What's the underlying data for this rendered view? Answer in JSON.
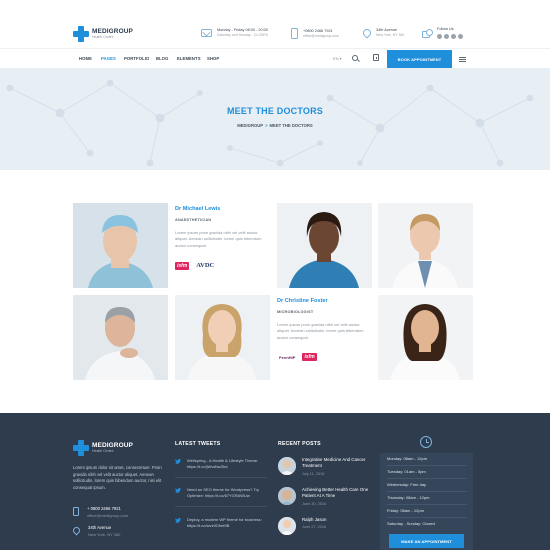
{
  "brand": {
    "name": "MEDIGROUP",
    "tagline": "Health Centre"
  },
  "header": {
    "hours": {
      "line1": "Monday - Friday 08:00 - 20:00",
      "line2": "Saturday and Sunday - CLOSED"
    },
    "contact": {
      "line1": "+0800 2466 7921",
      "line2": "office@medigroup.com"
    },
    "address": {
      "line1": "34th Avenue",
      "line2": "New York, NY 360"
    },
    "follow": {
      "title": "Follow Us"
    }
  },
  "nav": {
    "items": [
      "HOME",
      "PAGES",
      "PORTFOLIO",
      "BLOG",
      "ELEMENTS",
      "SHOP"
    ],
    "active_index": 1,
    "language": "EN ▾",
    "book_label": "BOOK APPOINTMENT"
  },
  "banner": {
    "title": "MEET THE DOCTORS",
    "breadcrumb": [
      "MEDIGROUP",
      "MEET THE DOCTORS"
    ],
    "breadcrumb_sep": ">"
  },
  "doctors": [
    {
      "name": "Dr Michael Lewis",
      "role": "ANAESTHETICIAN",
      "bio": "Lorem ipsum proin gravida nibh vel velit auctor aliquet. Aenean sollicitudin, lorem quis bibendum auctor consequat.",
      "logos": [
        "isfm",
        "AVDC"
      ]
    },
    {
      "name": "Dr Christine Foster",
      "role": "MICROBIOLOGIST",
      "bio": "Lorem ipsum proin gravida nibh vel velit auctor aliquet. Aenean sollicitudin, lorem quis bibendum auctor consequat.",
      "logos": [
        "PennHIP",
        "isfm"
      ]
    }
  ],
  "footer": {
    "about": "Lorem ipsum dolor sit amet, consectetuer. Proin gravida nibh vel velit auctor aliquet. Aenean sollicitudin, lorem quis bibendum auctor, nisi elit consequat ipsum.",
    "phone": {
      "line1": "+ 0800 2466 7921",
      "line2": "office@medigroup.com"
    },
    "address": {
      "line1": "34th Avenue",
      "line2": "New York, NY 360"
    },
    "tweets_title": "LATEST TWEETS",
    "tweets": [
      "Wellspring - A Health & Lifestyle Theme: https://t.co/jWvdhwZhd",
      "Need an SEO theme for Wordpress? Try Optimize: https://t.co/67YGRAWUw",
      "Deploy, a modern WP theme for business: https://t.co/wvz9Ohnt9B"
    ],
    "posts_title": "RECENT POSTS",
    "posts": [
      {
        "title": "Integrative Medicine And Cancer Treatment",
        "date": "July 11, 2016"
      },
      {
        "title": "Achieving Better Health Care One Patient At A Time",
        "date": "June 30, 2016"
      },
      {
        "title": "Ralph Jason",
        "date": "June 27, 2016"
      }
    ],
    "hours": [
      "Monday: 08am - 12pm",
      "Tuesday: 01am - 5pm",
      "Wednesday: Free day",
      "Thursday: 08am - 12pm",
      "Friday: 08am - 12pm",
      "Saturday - Sunday: Closed"
    ],
    "hours_button": "MAKE AN APPOINTMENT"
  },
  "colors": {
    "accent": "#1f8fdc",
    "footer_bg": "#2e3c4e",
    "banner_bg": "#e7eef4",
    "text_dark": "#3a4550"
  },
  "icons": [
    "medical-cross-logo",
    "mail-icon",
    "phone-icon",
    "map-pin-icon",
    "follow-icon",
    "search-icon",
    "bag-icon",
    "menu-icon",
    "twitter-icon",
    "clock-icon"
  ]
}
